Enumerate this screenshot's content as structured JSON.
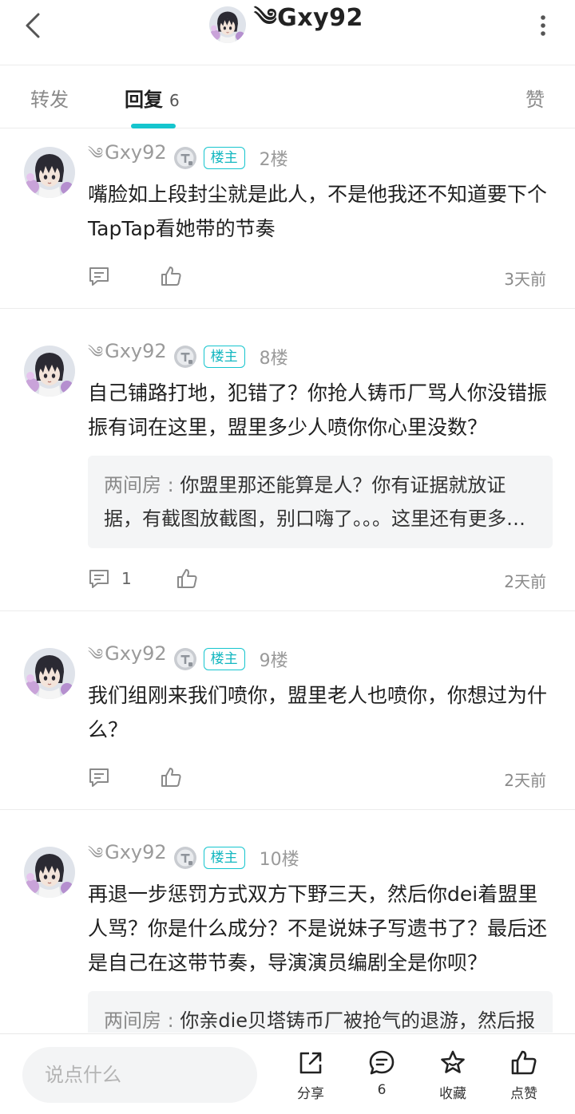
{
  "header": {
    "title": "༄Gxy92"
  },
  "tabs": {
    "forward": "转发",
    "reply": "回复",
    "reply_count": "6",
    "like": "赞"
  },
  "posts": [
    {
      "author": "Gxy92",
      "host_badge": "楼主",
      "floor": "2楼",
      "content": "嘴脸如上段封尘就是此人，不是他我还不知道要下个TapTap看她带的节奏",
      "time": "3天前"
    },
    {
      "author": "Gxy92",
      "host_badge": "楼主",
      "floor": "8楼",
      "content": "自己铺路打地，犯错了？你抢人铸币厂骂人你没错振振有词在这里，盟里多少人喷你你心里没数？",
      "quote_name": "两间房",
      "quote_text": "你盟里那还能算是人？你有证据就放证据，有截图放截图，别口嗨了。。。这里还有更多内容",
      "comment_count": "1",
      "time": "2天前"
    },
    {
      "author": "Gxy92",
      "host_badge": "楼主",
      "floor": "9楼",
      "content": "我们组刚来我们喷你，盟里老人也喷你，你想过为什么？",
      "time": "2天前"
    },
    {
      "author": "Gxy92",
      "host_badge": "楼主",
      "floor": "10楼",
      "content": "再退一步惩罚方式双方下野三天，然后你dei着盟里人骂？你是什么成分？不是说妹子写遗书了？最后还是自己在这带节奏，导演演员编剧全是你呗？",
      "quote_name": "两间房",
      "quote_text": "你亲die贝塔铸币厂被抢气的退游，然后报复性飞地，你带团队骂人霸凌，世界造谣",
      "time": ""
    }
  ],
  "bottom_bar": {
    "input_placeholder": "说点什么",
    "share_label": "分享",
    "comment_count": "6",
    "favorite_label": "收藏",
    "like_label": "点赞"
  },
  "colors": {
    "accent": "#15c5ce",
    "muted_text": "#9a9a9a",
    "divider": "#ececec"
  },
  "icons": [
    "back-icon",
    "more-icon",
    "comment-icon",
    "like-icon",
    "share-icon",
    "star-icon",
    "tier-badge-icon"
  ]
}
